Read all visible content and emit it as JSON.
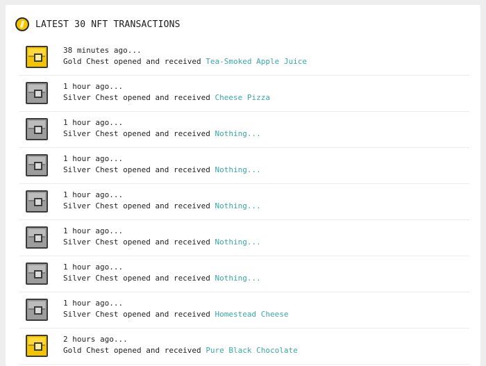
{
  "header": {
    "title": "LATEST 30 NFT TRANSACTIONS",
    "icon": "coin-icon"
  },
  "colors": {
    "prize_link": "#3aa8a5",
    "gold_chest": "#f5c400",
    "silver_chest": "#9c9c9c"
  },
  "transactions": [
    {
      "time": "38 minutes ago...",
      "chest": "gold",
      "action": "Gold Chest opened and received ",
      "item": "Tea-Smoked Apple Juice"
    },
    {
      "time": "1 hour ago...",
      "chest": "silver",
      "action": "Silver Chest opened and received ",
      "item": "Cheese Pizza"
    },
    {
      "time": "1 hour ago...",
      "chest": "silver",
      "action": "Silver Chest opened and received ",
      "item": "Nothing..."
    },
    {
      "time": "1 hour ago...",
      "chest": "silver",
      "action": "Silver Chest opened and received ",
      "item": "Nothing..."
    },
    {
      "time": "1 hour ago...",
      "chest": "silver",
      "action": "Silver Chest opened and received ",
      "item": "Nothing..."
    },
    {
      "time": "1 hour ago...",
      "chest": "silver",
      "action": "Silver Chest opened and received ",
      "item": "Nothing..."
    },
    {
      "time": "1 hour ago...",
      "chest": "silver",
      "action": "Silver Chest opened and received ",
      "item": "Nothing..."
    },
    {
      "time": "1 hour ago...",
      "chest": "silver",
      "action": "Silver Chest opened and received ",
      "item": "Homestead Cheese"
    },
    {
      "time": "2 hours ago...",
      "chest": "gold",
      "action": "Gold Chest opened and received ",
      "item": "Pure Black Chocolate"
    }
  ]
}
